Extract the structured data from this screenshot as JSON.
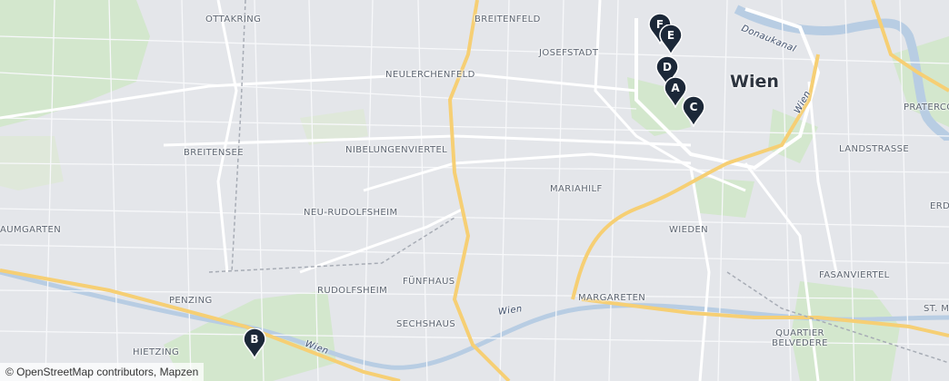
{
  "map": {
    "districts": [
      {
        "id": "ottakring",
        "label": "OTTAKRING"
      },
      {
        "id": "breitenfeld",
        "label": "BREITENFELD"
      },
      {
        "id": "josefstadt",
        "label": "JOSEFSTADT"
      },
      {
        "id": "neulerchenfeld",
        "label": "NEULERCHENFELD"
      },
      {
        "id": "breitensee",
        "label": "BREITENSEE"
      },
      {
        "id": "nibelungenviertel",
        "label": "NIBELUNGENVIERTEL"
      },
      {
        "id": "mariahilf",
        "label": "MARIAHILF"
      },
      {
        "id": "neu-rudolfsheim",
        "label": "NEU-RUDOLFSHEIM"
      },
      {
        "id": "baumgarten",
        "label": "AUMGARTEN"
      },
      {
        "id": "wieden",
        "label": "WIEDEN"
      },
      {
        "id": "landstrasse",
        "label": "LANDSTRASSE"
      },
      {
        "id": "pratercottage",
        "label": "PRATERCOTT"
      },
      {
        "id": "erdberg",
        "label": "ERDE"
      },
      {
        "id": "rudolfsheim",
        "label": "RUDOLFSHEIM"
      },
      {
        "id": "fuenfhaus",
        "label": "FÜNFHAUS"
      },
      {
        "id": "penzing",
        "label": "PENZING"
      },
      {
        "id": "margareten",
        "label": "MARGARETEN"
      },
      {
        "id": "fasanviertel",
        "label": "FASANVIERTEL"
      },
      {
        "id": "stmarx",
        "label": "ST. MA"
      },
      {
        "id": "sechshaus",
        "label": "SECHSHAUS"
      },
      {
        "id": "hietzing",
        "label": "HIETZING"
      },
      {
        "id": "quartier-belvedere",
        "label": "QUARTIER BELVEDERE"
      }
    ],
    "city": "Wien",
    "water": {
      "canal": "Donaukanal",
      "river": "Wien"
    },
    "markers": [
      {
        "id": "F",
        "label": "F"
      },
      {
        "id": "E",
        "label": "E"
      },
      {
        "id": "D",
        "label": "D"
      },
      {
        "id": "A",
        "label": "A"
      },
      {
        "id": "C",
        "label": "C"
      },
      {
        "id": "B",
        "label": "B"
      }
    ],
    "colors": {
      "background": "#e4e6ea",
      "park": "#d3e7cd",
      "water": "#b8cde3",
      "motorway": "#f6cf74",
      "road": "#ffffff",
      "marker": "#1c2838"
    }
  },
  "attribution": "© OpenStreetMap contributors, Mapzen"
}
